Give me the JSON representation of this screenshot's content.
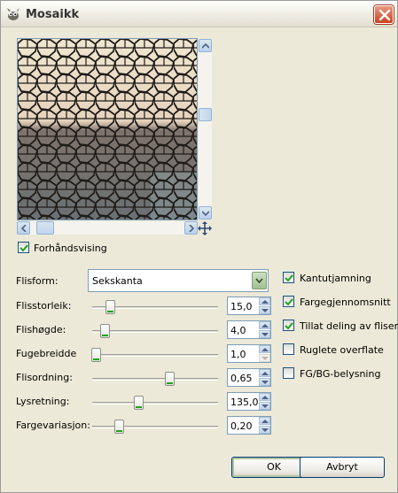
{
  "window": {
    "title": "Mosaikk"
  },
  "preview": {
    "checkbox_label": "Forhåndsvising",
    "checked": true
  },
  "form": {
    "tile_form_label": "Flisform:",
    "tile_form_value": "Sekskanta",
    "sliders": [
      {
        "label": "Flisstorleik:",
        "value": "15,0",
        "level": 0.12
      },
      {
        "label": "Flishøgde:",
        "value": "4,0",
        "level": 0.08
      },
      {
        "label": "Fugebreidde",
        "value": "1,0",
        "level": 0.0
      },
      {
        "label": "Flisordning:",
        "value": "0,65",
        "level": 0.63
      },
      {
        "label": "Lysretning:",
        "value": "135,0",
        "level": 0.37
      },
      {
        "label": "Fargevariasjon:",
        "value": "0,20",
        "level": 0.2
      }
    ]
  },
  "options": [
    {
      "label": "Kantutjamning",
      "checked": true
    },
    {
      "label": "Fargegjennomsnitt",
      "checked": true
    },
    {
      "label": "Tillat deling av fliser",
      "checked": true
    },
    {
      "label": "Ruglete overflate",
      "checked": false
    },
    {
      "label": "FG/BG-belysning",
      "checked": false
    }
  ],
  "buttons": {
    "ok": "OK",
    "cancel": "Avbryt"
  },
  "icons": {
    "app": "gimp-icon",
    "close": "close-icon",
    "move": "move-arrows-icon",
    "scroll_up": "arrow-up-icon",
    "scroll_down": "arrow-down-icon",
    "scroll_left": "arrow-left-icon",
    "scroll_right": "arrow-right-icon",
    "dropdown": "chevron-down-icon"
  },
  "colors": {
    "check": "#21a121",
    "close_button": "#c9411e",
    "border_accent": "#7f9db9"
  }
}
